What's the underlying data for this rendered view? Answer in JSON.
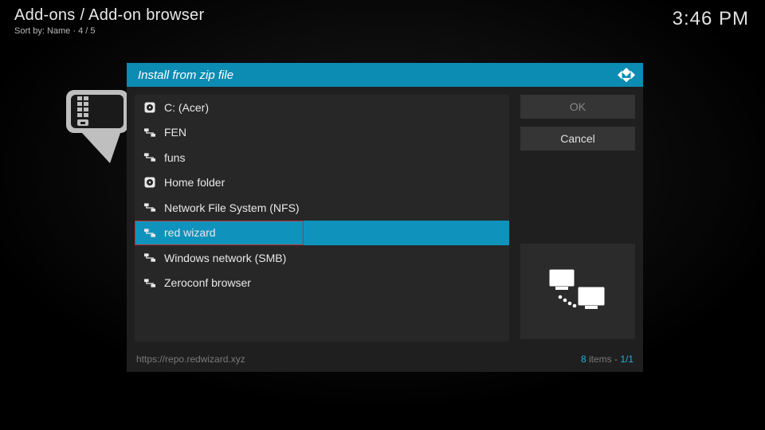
{
  "header": {
    "breadcrumb": "Add-ons / Add-on browser",
    "sort_label": "Sort by: Name  ·  4 / 5"
  },
  "clock": "3:46 PM",
  "dialog": {
    "title": "Install from zip file",
    "ok_label": "OK",
    "cancel_label": "Cancel",
    "footer_path": "https://repo.redwizard.xyz",
    "items_count": "8",
    "items_word": " items - ",
    "page": "1/1"
  },
  "files": [
    {
      "label": "C: (Acer)",
      "icon": "disk",
      "selected": false
    },
    {
      "label": "FEN",
      "icon": "network",
      "selected": false
    },
    {
      "label": "funs",
      "icon": "network",
      "selected": false
    },
    {
      "label": "Home folder",
      "icon": "disk",
      "selected": false
    },
    {
      "label": "Network File System (NFS)",
      "icon": "network",
      "selected": false
    },
    {
      "label": "red wizard",
      "icon": "network",
      "selected": true
    },
    {
      "label": "Windows network (SMB)",
      "icon": "network",
      "selected": false
    },
    {
      "label": "Zeroconf browser",
      "icon": "network",
      "selected": false
    }
  ]
}
